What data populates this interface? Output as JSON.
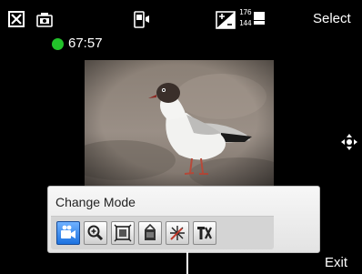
{
  "status_bar": {
    "resolution_top": "176",
    "resolution_bottom": "144",
    "select_label": "Select"
  },
  "recording": {
    "indicator_color": "#22c22a",
    "timer": "67:57"
  },
  "mode_panel": {
    "title": "Change Mode",
    "tools": [
      {
        "name": "video-camera-mode",
        "active": true
      },
      {
        "name": "zoom",
        "active": false
      },
      {
        "name": "frame",
        "active": false
      },
      {
        "name": "scene",
        "active": false
      },
      {
        "name": "effects",
        "active": false
      },
      {
        "name": "settings",
        "active": false
      }
    ]
  },
  "softkeys": {
    "exit_label": "Exit"
  }
}
